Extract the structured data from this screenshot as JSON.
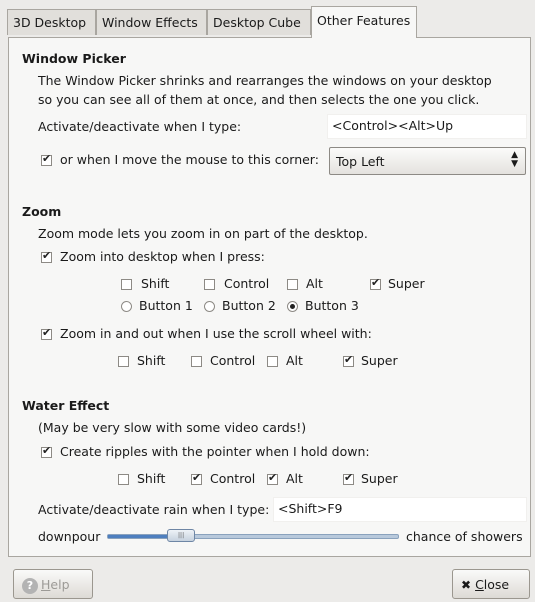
{
  "tabs": [
    "3D Desktop",
    "Window Effects",
    "Desktop Cube",
    "Other Features"
  ],
  "window_picker": {
    "heading": "Window Picker",
    "desc_line1": "The Window Picker shrinks and rearranges the windows on your desktop",
    "desc_line2": "so you can see all of them at once, and then selects the one you click.",
    "activate_label": "Activate/deactivate when I type:",
    "activate_value": "<Control><Alt>Up",
    "mouse_corner_label": "or when I move the mouse to this corner:",
    "mouse_corner_checked": true,
    "corner_value": "Top Left"
  },
  "zoom": {
    "heading": "Zoom",
    "desc": "Zoom mode lets you zoom in on part of the desktop.",
    "press_label": "Zoom into desktop when I press:",
    "press_checked": true,
    "press_modifiers": [
      {
        "label": "Shift",
        "checked": false
      },
      {
        "label": "Control",
        "checked": false
      },
      {
        "label": "Alt",
        "checked": false
      },
      {
        "label": "Super",
        "checked": true
      }
    ],
    "buttons": [
      {
        "label": "Button 1",
        "selected": false
      },
      {
        "label": "Button 2",
        "selected": false
      },
      {
        "label": "Button 3",
        "selected": true
      }
    ],
    "scroll_label": "Zoom in and out when I use the scroll wheel with:",
    "scroll_checked": true,
    "scroll_modifiers": [
      {
        "label": "Shift",
        "checked": false
      },
      {
        "label": "Control",
        "checked": false
      },
      {
        "label": "Alt",
        "checked": false
      },
      {
        "label": "Super",
        "checked": true
      }
    ]
  },
  "water": {
    "heading": "Water Effect",
    "note": "(May be very slow with some video cards!)",
    "ripples_label": "Create ripples with the pointer when I hold down:",
    "ripples_checked": true,
    "ripple_modifiers": [
      {
        "label": "Shift",
        "checked": false
      },
      {
        "label": "Control",
        "checked": true
      },
      {
        "label": "Alt",
        "checked": true
      },
      {
        "label": "Super",
        "checked": true
      }
    ],
    "rain_label": "Activate/deactivate rain when I type:",
    "rain_value": "<Shift>F9",
    "slider_left_label": "downpour",
    "slider_right_label": "chance of showers",
    "slider_fraction": 0.24
  },
  "buttons": {
    "help_underlined": "H",
    "help_rest": "elp",
    "close_underlined": "C",
    "close_rest": "lose",
    "close_icon": "✖"
  }
}
